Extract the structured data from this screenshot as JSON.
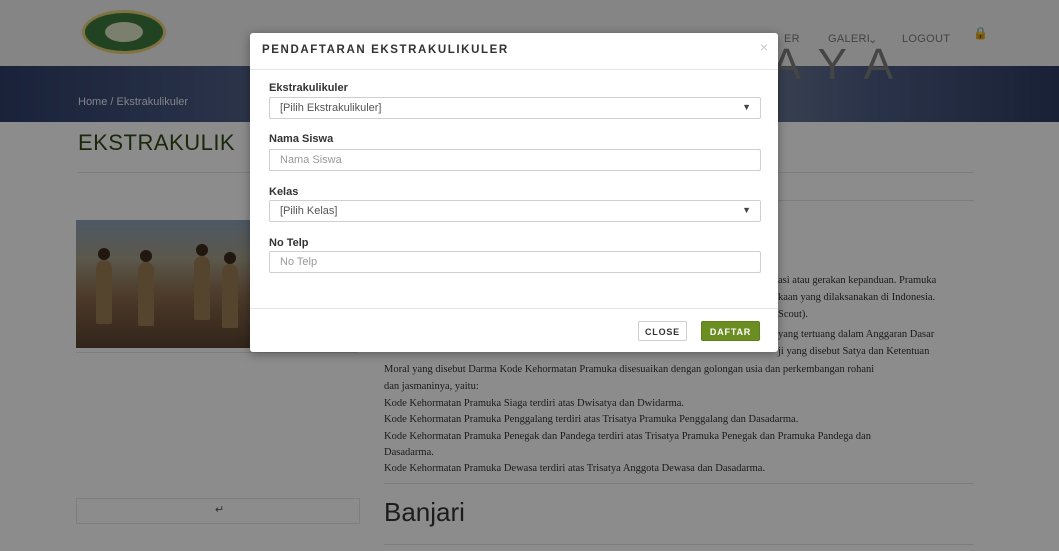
{
  "nav": {
    "items": [
      "ER",
      "GALERI",
      "LOGOUT"
    ]
  },
  "breadcrumb": {
    "home": "Home",
    "separator": "/",
    "current": "Ekstrakulikuler"
  },
  "page": {
    "title": "EKSTRAKULIK"
  },
  "watermark": "SURABAYA",
  "article": {
    "fragments": [
      "asi atau gerakan kepanduan. Pramuka",
      "kaan yang dilaksanakan di Indonesia.",
      "Scout).",
      "yang tertuang dalam Anggaran Dasar",
      "ji yang disebut Satya dan Ketentuan"
    ],
    "lines": [
      "Moral yang disebut Darma Kode Kehormatan Pramuka disesuaikan dengan golongan usia dan perkembangan rohani",
      "dan jasmaninya, yaitu:",
      "Kode Kehormatan Pramuka Siaga terdiri atas Dwisatya dan Dwidarma.",
      "Kode Kehormatan Pramuka Penggalang terdiri atas Trisatya Pramuka Penggalang dan Dasadarma.",
      "Kode Kehormatan Pramuka Penegak dan Pandega terdiri atas Trisatya Pramuka Penegak dan Pramuka Pandega dan",
      "Dasadarma.",
      "Kode Kehormatan Pramuka Dewasa terdiri atas Trisatya Anggota Dewasa dan Dasadarma."
    ],
    "next_heading": "Banjari"
  },
  "modal": {
    "title": "PENDAFTARAN EKSTRAKULIKULER",
    "close_glyph": "×",
    "fields": {
      "ekstra": {
        "label": "Ekstrakulikuler",
        "value": "[Pilih Ekstrakulikuler]"
      },
      "nama": {
        "label": "Nama Siswa",
        "placeholder": "Nama Siswa"
      },
      "kelas": {
        "label": "Kelas",
        "value": "[Pilih Kelas]"
      },
      "telp": {
        "label": "No Telp",
        "placeholder": "No Telp"
      }
    },
    "buttons": {
      "close": "CLOSE",
      "submit": "DAFTAR"
    }
  },
  "icons": {
    "lock": "lock-icon",
    "dropdown": "chevron-down-icon",
    "close": "close-icon"
  },
  "colors": {
    "accent": "#6b8e23",
    "title": "#314a14"
  }
}
